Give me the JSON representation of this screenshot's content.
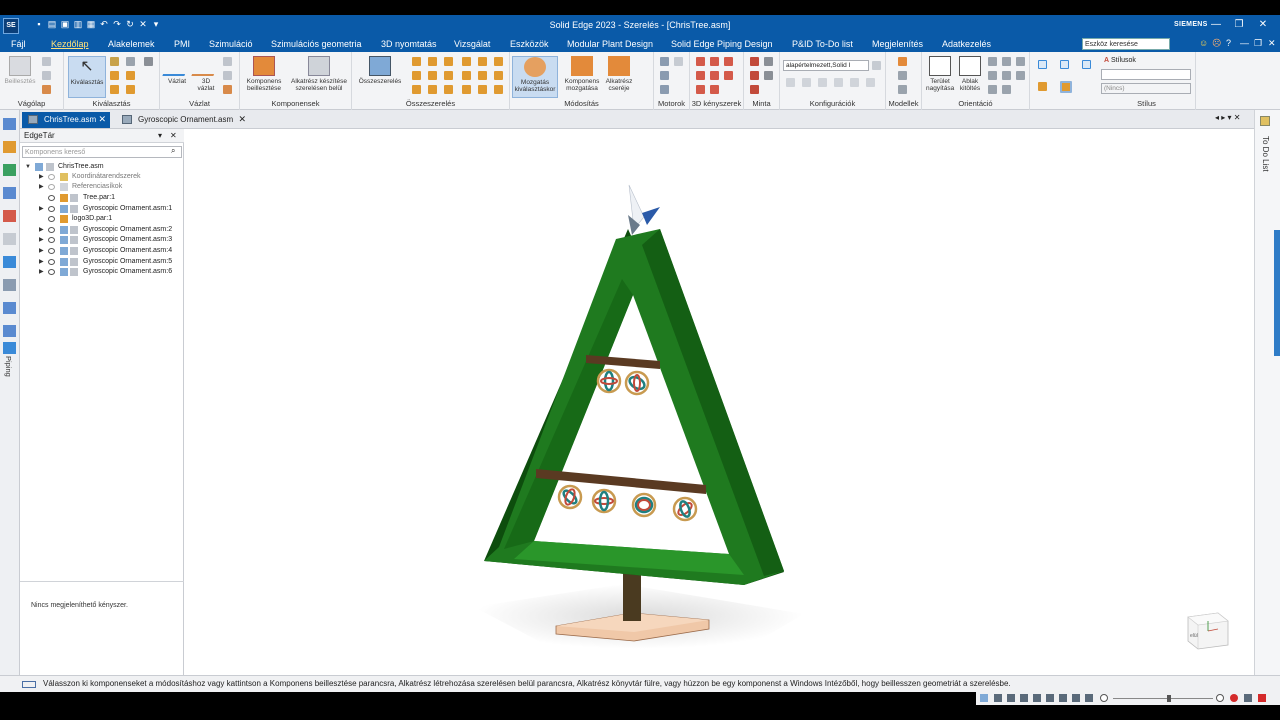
{
  "window": {
    "title": "Solid Edge 2023 - Szerelés - [ChrisTree.asm]",
    "brand": "SIEMENS",
    "logo": "SE",
    "controls": [
      "—",
      "❐",
      "✕"
    ]
  },
  "menu": {
    "tabs": [
      "Fájl",
      "Kezdőlap",
      "Alakelemek",
      "PMI",
      "Szimuláció",
      "Szimulációs geometria",
      "3D nyomtatás",
      "Vizsgálat",
      "Eszközök",
      "Modular Plant Design",
      "Solid Edge Piping Design",
      "P&ID To-Do list",
      "Megjelenítés",
      "Adatkezelés"
    ],
    "active": "Kezdőlap",
    "search_placeholder": "Eszköz keresése"
  },
  "ribbon": {
    "groups": [
      {
        "id": "vagolap",
        "label": "Vágólap",
        "buttons": [
          "Beillesztés"
        ]
      },
      {
        "id": "kivalasztas",
        "label": "Kiválasztás",
        "buttons": [
          "Kiválasztás"
        ]
      },
      {
        "id": "vazlat",
        "label": "Vázlat",
        "buttons": [
          "Vázlat",
          "3D vázlat"
        ]
      },
      {
        "id": "komponensek",
        "label": "Komponensek",
        "buttons": [
          "Komponens beillesztése",
          "Alkatrész készítése szerelésen belül"
        ]
      },
      {
        "id": "osszeszereles",
        "label": "Összeszerelés",
        "buttons": [
          "Összeszerelés"
        ]
      },
      {
        "id": "modositas",
        "label": "Módosítás",
        "buttons": [
          "Mozgatás kiválasztáskor",
          "Komponens mozgatása",
          "Alkatrész cseréje"
        ]
      },
      {
        "id": "motorok",
        "label": "Motorok",
        "buttons": []
      },
      {
        "id": "3dkenyszerek",
        "label": "3D kényszerek",
        "buttons": []
      },
      {
        "id": "minta",
        "label": "Minta",
        "buttons": []
      },
      {
        "id": "konfiguraciok",
        "label": "Konfigurációk",
        "combo": "alapértelmezett,Solid I"
      },
      {
        "id": "modellek",
        "label": "Modellek",
        "buttons": []
      },
      {
        "id": "orientacio",
        "label": "Orientáció",
        "buttons": [
          "Terület nagyítása",
          "Ablak kitöltés"
        ]
      },
      {
        "id": "stilus",
        "label": "Stílus",
        "style_label": "Stílusok",
        "combo": "(Nincs)"
      }
    ]
  },
  "doc_tabs": [
    {
      "label": "ChrisTree.asm",
      "active": true
    },
    {
      "label": "Gyroscopic Ornament.asm",
      "active": false
    }
  ],
  "pane": {
    "title": "EdgeTár",
    "search_placeholder": "Komponens kereső",
    "tree": [
      {
        "label": "ChrisTree.asm",
        "level": 0,
        "dim": false
      },
      {
        "label": "Koordinátarendszerek",
        "level": 1,
        "dim": true
      },
      {
        "label": "Referenciasíkok",
        "level": 1,
        "dim": true
      },
      {
        "label": "Tree.par:1",
        "level": 1,
        "dim": false
      },
      {
        "label": "Gyroscopic Ornament.asm:1",
        "level": 1,
        "dim": false
      },
      {
        "label": "logo3D.par:1",
        "level": 1,
        "dim": false
      },
      {
        "label": "Gyroscopic Ornament.asm:2",
        "level": 1,
        "dim": false
      },
      {
        "label": "Gyroscopic Ornament.asm:3",
        "level": 1,
        "dim": false
      },
      {
        "label": "Gyroscopic Ornament.asm:4",
        "level": 1,
        "dim": false
      },
      {
        "label": "Gyroscopic Ornament.asm:5",
        "level": 1,
        "dim": false
      },
      {
        "label": "Gyroscopic Ornament.asm:6",
        "level": 1,
        "dim": false
      }
    ],
    "constraints_message": "Nincs megjeleníthető kényszer."
  },
  "left_toolbar": {
    "piping_label": "Piping"
  },
  "right_strip": {
    "todo_label": "To Do List"
  },
  "viewcube": {
    "face_label": "elül"
  },
  "status": {
    "message": "Válasszon ki komponenseket a módosításhoz vagy kattintson a Komponens beillesztése parancsra, Alkatrész létrehozása szerelésen belül parancsra, Alkatrész könyvtár fülre, vagy húzzon be egy komponenst a Windows Intézőből, hogy beillesszen geometriát a szerelésbe."
  },
  "colors": {
    "title_bg": "#0a5aa8",
    "tree_green": "#1f7a1f",
    "tree_dark": "#0d4d0d",
    "branch": "#5a3a22",
    "base": "#f0c8a8"
  }
}
